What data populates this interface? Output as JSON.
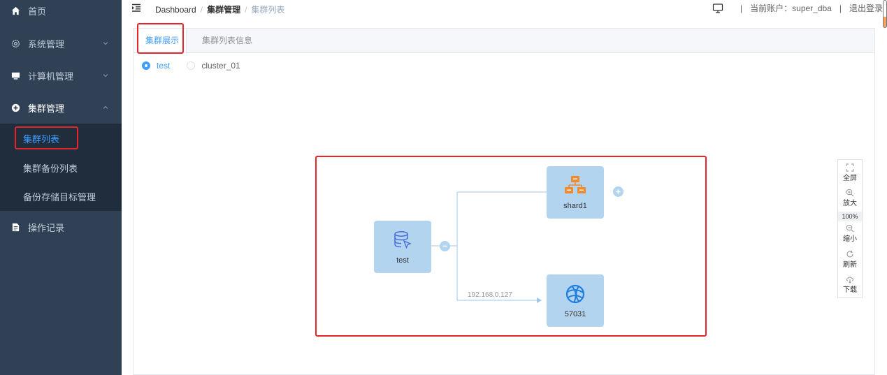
{
  "sidebar": {
    "items": [
      {
        "label": "首页",
        "icon": "home-icon"
      },
      {
        "label": "系统管理",
        "icon": "gear-icon"
      },
      {
        "label": "计算机管理",
        "icon": "monitor-icon"
      },
      {
        "label": "集群管理",
        "icon": "plus-circle-icon"
      },
      {
        "label": "操作记录",
        "icon": "document-icon"
      }
    ],
    "cluster_sub": [
      {
        "label": "集群列表"
      },
      {
        "label": "集群备份列表"
      },
      {
        "label": "备份存储目标管理"
      }
    ]
  },
  "header": {
    "breadcrumb": [
      "Dashboard",
      "集群管理",
      "集群列表"
    ],
    "separator": "/",
    "account_label": "当前账户：super_dba",
    "divider": "|",
    "logout": "退出登录"
  },
  "tabs": [
    {
      "label": "集群展示",
      "active": true
    },
    {
      "label": "集群列表信息",
      "active": false
    }
  ],
  "clusters": [
    {
      "label": "test",
      "checked": true
    },
    {
      "label": "cluster_01",
      "checked": false
    }
  ],
  "topology": {
    "root": {
      "label": "test",
      "icon": "database-icon"
    },
    "shard": {
      "label": "shard1",
      "icon": "network-icon"
    },
    "comp": {
      "label": "57031",
      "icon": "globe-icon"
    },
    "edge_label": "192.168.0.127"
  },
  "toolbar": {
    "fullscreen": "全屏",
    "zoom_in": "放大",
    "zoom_level": "100%",
    "zoom_out": "缩小",
    "refresh": "刷新",
    "download": "下载"
  },
  "colors": {
    "sidebar_bg": "#304156",
    "accent": "#409eff",
    "node_bg": "#b3d4ef",
    "highlight_box": "#e5252a",
    "shard_icon": "#f08a30"
  }
}
